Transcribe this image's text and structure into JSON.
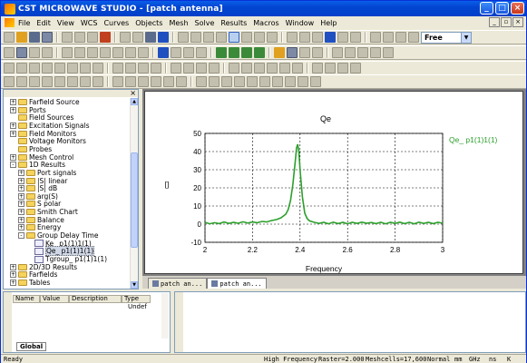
{
  "window": {
    "title": "CST MICROWAVE STUDIO - [patch antenna]"
  },
  "menu": [
    "File",
    "Edit",
    "View",
    "WCS",
    "Curves",
    "Objects",
    "Mesh",
    "Solve",
    "Results",
    "Macros",
    "Window",
    "Help"
  ],
  "toolbar": {
    "combo_value": "Free"
  },
  "tree": {
    "items": [
      {
        "label": "Farfield Source",
        "level": 0,
        "expander": "+"
      },
      {
        "label": "Ports",
        "level": 0,
        "expander": "+"
      },
      {
        "label": "Field Sources",
        "level": 0,
        "expander": ""
      },
      {
        "label": "Excitation Signals",
        "level": 0,
        "expander": "+"
      },
      {
        "label": "Field Monitors",
        "level": 0,
        "expander": "+"
      },
      {
        "label": "Voltage Monitors",
        "level": 0,
        "expander": ""
      },
      {
        "label": "Probes",
        "level": 0,
        "expander": ""
      },
      {
        "label": "Mesh Control",
        "level": 0,
        "expander": "+"
      },
      {
        "label": "1D Results",
        "level": 0,
        "expander": "-"
      },
      {
        "label": "Port signals",
        "level": 1,
        "expander": "+"
      },
      {
        "label": "|S| linear",
        "level": 1,
        "expander": "+"
      },
      {
        "label": "|S| dB",
        "level": 1,
        "expander": "+"
      },
      {
        "label": "arg(S)",
        "level": 1,
        "expander": "+"
      },
      {
        "label": "S polar",
        "level": 1,
        "expander": "+"
      },
      {
        "label": "Smith Chart",
        "level": 1,
        "expander": "+"
      },
      {
        "label": "Balance",
        "level": 1,
        "expander": "+"
      },
      {
        "label": "Energy",
        "level": 1,
        "expander": "+"
      },
      {
        "label": "Group Delay Time",
        "level": 1,
        "expander": "-"
      },
      {
        "label": "Ke_ p1(1)1(1)",
        "level": 2,
        "expander": "",
        "curve": true
      },
      {
        "label": "Qe_ p1(1)1(1)",
        "level": 2,
        "expander": "",
        "curve": true,
        "selected": true
      },
      {
        "label": "Tgroup_ p1(1)1(1)",
        "level": 2,
        "expander": "",
        "curve": true
      },
      {
        "label": "2D/3D Results",
        "level": 0,
        "expander": "+"
      },
      {
        "label": "Farfields",
        "level": 0,
        "expander": "+"
      },
      {
        "label": "Tables",
        "level": 0,
        "expander": "+"
      }
    ]
  },
  "doc_tabs": [
    "patch an...",
    "patch an..."
  ],
  "params": {
    "headers": [
      "Name",
      "Value",
      "Description",
      "Type"
    ],
    "row_type": "Undef",
    "tab": "Global"
  },
  "status": {
    "left": "Ready",
    "mode": "High Frequency",
    "raster": "Raster=2.000",
    "meshcells": "Meshcells=17,600",
    "view": "Normal",
    "length_unit": "mm",
    "freq_unit": "GHz",
    "time_unit": "ns",
    "temp_unit": "K"
  },
  "chart_data": {
    "type": "line",
    "title": "Qe",
    "xlabel": "Frequency",
    "ylabel": "[]",
    "xlim": [
      2,
      3
    ],
    "ylim": [
      -10,
      50
    ],
    "x_ticks": [
      "2",
      "2.2",
      "2.4",
      "2.6",
      "2.8",
      "3"
    ],
    "y_ticks": [
      "50",
      "40",
      "30",
      "20",
      "10",
      "0",
      "-10"
    ],
    "grid": true,
    "legend_position": "top-right",
    "series": [
      {
        "name": "Qe_ p1(1)1(1)",
        "color": "#2ca02c",
        "x": [
          2.0,
          2.02,
          2.04,
          2.06,
          2.08,
          2.1,
          2.12,
          2.14,
          2.16,
          2.18,
          2.2,
          2.22,
          2.24,
          2.26,
          2.28,
          2.3,
          2.32,
          2.34,
          2.35,
          2.36,
          2.37,
          2.38,
          2.385,
          2.39,
          2.395,
          2.4,
          2.41,
          2.42,
          2.43,
          2.44,
          2.46,
          2.48,
          2.5,
          2.52,
          2.54,
          2.56,
          2.58,
          2.6,
          2.62,
          2.64,
          2.66,
          2.68,
          2.7,
          2.72,
          2.74,
          2.76,
          2.78,
          2.8,
          2.82,
          2.84,
          2.86,
          2.88,
          2.9,
          2.92,
          2.94,
          2.96,
          2.98,
          3.0
        ],
        "y": [
          1.0,
          0.2,
          0.8,
          0.3,
          1.2,
          0.4,
          1.0,
          0.5,
          1.3,
          0.6,
          1.2,
          0.8,
          1.5,
          1.2,
          2.0,
          2.5,
          3.5,
          5.5,
          8.0,
          13.0,
          22.0,
          35.0,
          42.0,
          44.0,
          40.0,
          30.0,
          15.0,
          6.0,
          3.0,
          1.8,
          1.0,
          0.4,
          1.0,
          0.2,
          1.1,
          0.3,
          1.0,
          0.2,
          1.0,
          0.4,
          1.1,
          0.5,
          0.9,
          0.3,
          1.0,
          0.2,
          1.0,
          0.4,
          1.1,
          0.3,
          1.0,
          0.2,
          1.1,
          0.4,
          1.0,
          0.3,
          1.0,
          0.5
        ]
      }
    ]
  }
}
